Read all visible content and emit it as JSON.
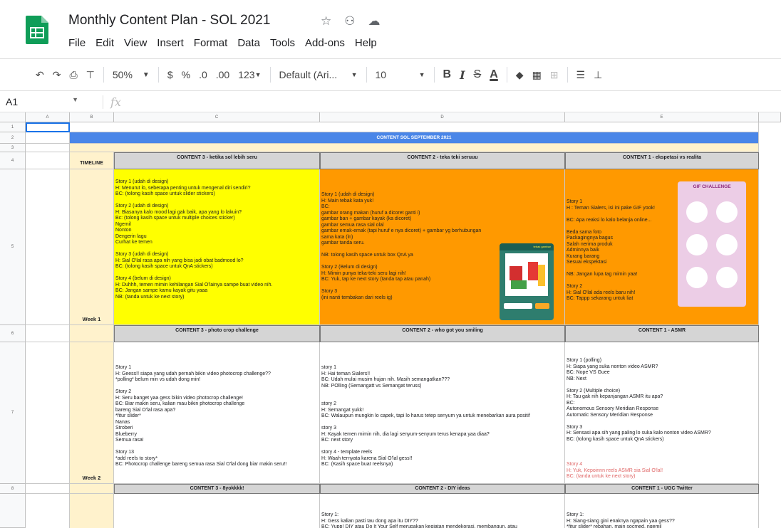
{
  "doc": {
    "title": "Monthly Content Plan - SOL 2021",
    "star_icon": "star-icon",
    "move_icon": "move-to-drive-icon",
    "cloud_icon": "cloud-status-icon"
  },
  "menu": [
    "File",
    "Edit",
    "View",
    "Insert",
    "Format",
    "Data",
    "Tools",
    "Add-ons",
    "Help"
  ],
  "toolbar": {
    "zoom": "50%",
    "currency": "$",
    "percent": "%",
    "dec_less": ".0",
    "dec_more": ".00",
    "more_formats": "123",
    "font": "Default (Ari...",
    "font_size": "10",
    "bold": "B",
    "italic": "I",
    "strike": "S",
    "text_color": "A"
  },
  "formula": {
    "cell_ref": "A1",
    "fx": "fx"
  },
  "columns": [
    "A",
    "B",
    "C",
    "D",
    "E"
  ],
  "rows": [
    "1",
    "2",
    "3",
    "4",
    "5",
    "6",
    "7",
    "8"
  ],
  "sheet": {
    "banner": "CONTENT SOL SEPTEMBER 2021",
    "timeline_label": "TIMELINE",
    "week1": "Week 1",
    "week2": "Week 2",
    "r4": [
      "CONTENT 3 - ketika sol lebih seru",
      "CONTENT 2 - teka teki seruuu",
      "CONTENT 1 - ekspetasi vs realita"
    ],
    "r5c": "Story 1 (udah di design)\nH: Menurut lo, seberapa penting untuk mengenal diri sendiri?\nBC: (tolong kasih space untuk slider stickers)\n\nStory 2 (udah di design)\nH: Biasanya kalo mood lagi gak baik, apa yang lo lakuin?\nBc: (tolong kasih space untuk multiple choices sticker)\nNgemil\nNonton\nDengerin lagu\nCurhat ke temen\n\nStory 3 (udah di design)\nH: Sial O'lal rasa apa nih yang bisa jadi obat badmood lo?\nBC: (tolong kasih space untuk QnA stickers)\n\nStory 4 (belum di design)\nH: Duhhh, temen mimin kehilangan Sial O'lainya sampe buat video nih.\nBC: Jangan sampe kamu kayak gitu yaaa\nNB: (tanda untuk ke next story)",
    "r5d": "Story 1 (udah di design)\nH: Main tebak kata yuk!\nBC:\ngambar orang makan (huruf a dicoret ganti i)\ngambar ban + gambar kayak (ka dicoret)\ngambar semua rasa sial olal\ngambar emak-emak (tapi huruf e nya dicoret) + gambar yg berhubungan sama kata (ln)\ngambar tanda seru.\n\nNB: tolong kasih space untuk box QnA ya\n\nStory 2 (Belum di design)\nH: Mimin punya teka-teki seru lagi nih!\nBC: Yuk, tap ke next story (tanda tap atau panah)\n\nStory 3\n(ini nanti tembakan dari reels ig)",
    "r5e": "Story 1\nH : Teman Sialers, isi ini pake GIF yook!\n\nBC: Apa reaksi lo kalo belanja online...\n\nBeda sama foto\nPackagingnya bagus\nSalah nerima produk\nAdminnya baik\nKurang barang\nSesuai ekspektasi\n\nNB: Jangan lupa tag mimin yaa!\n\nStory 2\nH: Sial O'lal ada reels baru nih!\nBC: Tappp sekarang untuk liat",
    "r6": [
      "CONTENT 3 - photo crop challenge",
      "CONTENT 2 - who got you smiling",
      "CONTENT 1 - ASMR"
    ],
    "r7c": "Story 1\nH: Geess!! siapa yang udah pernah bikin video photocrop challenge??\n*polling* belum min vs udah dong min!\n\nStory 2\nH: Seru banget yaa gess bikin video photocrop challenge!\nBC: Biar makin seru, kalian mau bikin photocrop challenge\nbareng Sial O'lal rasa apa?\n*fitur slider*\nNanas\nStroberi\nBlueberry\nSemua rasa!\n\nStory 13\n*add reels to story*\nBC: Photocrop challenge bareng semua rasa Sial O'lal dong biar makin seru!!",
    "r7d": "story 1\nH: Hai teman Sialers!!\nBC: Udah mulai musim hujan nih. Masih semangatkan???\nNB: POlling (Semangatt vs Semangat teruss)\n\n\nstory 2\nH: Semangat yukk!\nBC: Walaupun mungkin lo capek, tapi lo harus tetep senyum ya untuk menebarkan aura positif\n\nstory 3\nH: Kayak temen mimin nih, dia lagi senyum-senyum terus kenapa yaa diaa?\nBC: next story\n\nstory 4 - template reels\nH: Waah ternyata karena Sial O'lal gess!!\nBC: (Kasih space buat reelsnya)",
    "r7e": "Story 1 (polling)\nH: Siapa yang suka nonton video ASMR?\nBC: Nope VS Guee\nNB: Next\n\nStory 2 (Multiple choice)\nH: Tau gak nih kepanjangan ASMR itu apa?\nBC:\nAutonomous Sensory Meridian Response\nAutomatic Sensory Meridian Response\n\nStory 3\nH: Sensasi apa sih yang paling lo suka kalo nonton video ASMR?\nBC: (tolong kasih space untuk QnA stickers)",
    "r7e_red": "Story 4\nH: Yuk, Kepoinnn reels ASMR sia Sial O'lal!\nBC: (tanda untuk ke next story)",
    "r8": [
      "CONTENT 3 - 8yokkkk!",
      "CONTENT 2 - DIY ideas",
      "CONTENT 1 - UGC Twitter"
    ],
    "r9d": "Story 1:\nH: Gess kalian pasti tau dong apa itu DIY??\nBC: Yupp! DIY atau Do It Your Self merupakan kegiatan mendekorasi, membangun, atau",
    "r9e": "Story 1:\nH: Siang-siang gini enaknya ngapain yaa gess??\n*fitur slider* rebahan, main socmed, ngemil",
    "thumb_d": "tebak gambar",
    "thumb_e": "GIF CHALLENGE"
  },
  "colors": {
    "yellow": "#ffff00",
    "orange": "#ff9900",
    "banner_blue": "#4a86e8",
    "cream": "#fff2cc",
    "sheets_green": "#0f9d58"
  }
}
